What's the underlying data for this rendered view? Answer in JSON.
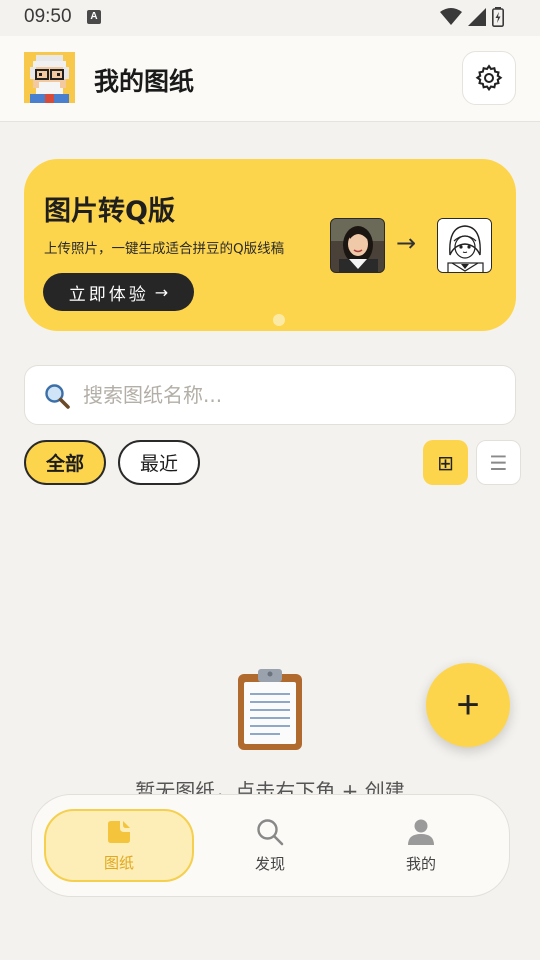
{
  "status_bar": {
    "time": "09:50",
    "a_icon": "A"
  },
  "app_bar": {
    "title": "我的图纸",
    "avatar_icon": "pixel-avatar-icon",
    "settings_icon": "gear-icon"
  },
  "banner": {
    "title": "图片转Q版",
    "subtitle": "上传照片，一键生成适合拼豆的Q版线稿",
    "cta_label": "立即体验",
    "cta_arrow": "→",
    "transform_arrow": "→"
  },
  "search": {
    "placeholder": "搜索图纸名称..."
  },
  "filters": {
    "all": "全部",
    "recent": "最近",
    "active": "all"
  },
  "view_toggle": {
    "grid_glyph": "⊞",
    "list_glyph": "☰",
    "active": "grid"
  },
  "empty_state": {
    "text": "暂无图纸，点击右下角 + 创建",
    "icon": "clipboard-icon"
  },
  "fab": {
    "label": "+"
  },
  "bottom_nav": {
    "items": [
      {
        "label": "图纸",
        "icon": "drawing-icon",
        "active": true
      },
      {
        "label": "发现",
        "icon": "search-icon",
        "active": false
      },
      {
        "label": "我的",
        "icon": "user-icon",
        "active": false
      }
    ]
  },
  "colors": {
    "accent": "#fdd54c",
    "background": "#f4f2ee",
    "dark": "#262626",
    "active_label": "#e0a81e"
  }
}
